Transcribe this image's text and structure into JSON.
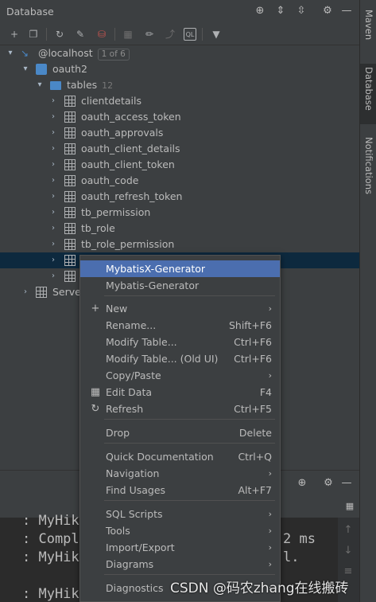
{
  "panel": {
    "title": "Database",
    "header_icons": [
      "crosshair-icon",
      "expand-all-icon",
      "collapse-all-icon",
      "gear-icon",
      "minimize-icon"
    ]
  },
  "toolbar_icons": [
    "add-icon",
    "duplicate-icon",
    "refresh-icon",
    "properties-icon",
    "datasource-icon",
    "table-grid-icon",
    "edit-icon",
    "jump-icon",
    "sql-console-icon",
    "filter-icon"
  ],
  "tree": {
    "datasource": {
      "label": "@localhost",
      "badge": "1 of 6"
    },
    "schema": {
      "label": "oauth2"
    },
    "tables_folder": {
      "label": "tables",
      "count": "12"
    },
    "tables": [
      "clientdetails",
      "oauth_access_token",
      "oauth_approvals",
      "oauth_client_details",
      "oauth_client_token",
      "oauth_code",
      "oauth_refresh_token",
      "tb_permission",
      "tb_role",
      "tb_role_permission",
      "",
      ""
    ],
    "server_node": {
      "label": "Server"
    }
  },
  "right_stripe": {
    "tabs": [
      "Maven",
      "Database",
      "Notifications"
    ]
  },
  "context_menu": {
    "items": [
      {
        "label": "MybatisX-Generator",
        "shortcut": "",
        "submenu": false,
        "icon": "",
        "highlight": true
      },
      {
        "label": "Mybatis-Generator",
        "shortcut": "",
        "submenu": false,
        "icon": ""
      },
      {
        "label": "New",
        "shortcut": "",
        "submenu": true,
        "icon": "plus-icon"
      },
      {
        "label": "Rename...",
        "shortcut": "Shift+F6",
        "submenu": false,
        "icon": ""
      },
      {
        "label": "Modify Table...",
        "shortcut": "Ctrl+F6",
        "submenu": false,
        "icon": ""
      },
      {
        "label": "Modify Table... (Old UI)",
        "shortcut": "Ctrl+F6",
        "submenu": false,
        "icon": ""
      },
      {
        "label": "Copy/Paste",
        "shortcut": "",
        "submenu": true,
        "icon": ""
      },
      {
        "label": "Edit Data",
        "shortcut": "F4",
        "submenu": false,
        "icon": "table-icon"
      },
      {
        "label": "Refresh",
        "shortcut": "Ctrl+F5",
        "submenu": false,
        "icon": "refresh-icon"
      },
      {
        "label": "Drop",
        "shortcut": "Delete",
        "submenu": false,
        "icon": ""
      },
      {
        "label": "Quick Documentation",
        "shortcut": "Ctrl+Q",
        "submenu": false,
        "icon": ""
      },
      {
        "label": "Navigation",
        "shortcut": "",
        "submenu": true,
        "icon": ""
      },
      {
        "label": "Find Usages",
        "shortcut": "Alt+F7",
        "submenu": false,
        "icon": ""
      },
      {
        "label": "SQL Scripts",
        "shortcut": "",
        "submenu": true,
        "icon": ""
      },
      {
        "label": "Tools",
        "shortcut": "",
        "submenu": true,
        "icon": ""
      },
      {
        "label": "Import/Export",
        "shortcut": "",
        "submenu": true,
        "icon": ""
      },
      {
        "label": "Diagrams",
        "shortcut": "",
        "submenu": true,
        "icon": ""
      },
      {
        "label": "Diagnostics",
        "shortcut": "",
        "submenu": true,
        "icon": ""
      }
    ]
  },
  "console": {
    "lines": [
      ": MyHik",
      ": Compl",
      ": MyHik",
      "",
      ": MyHik"
    ],
    "overflow_fragments": [
      "2 ms",
      "l."
    ]
  },
  "watermark": "CSDN @码农zhang在线搬砖",
  "colors": {
    "selection": "#0d293e",
    "menu_highlight": "#4b6eaf",
    "folder": "#4a88c7"
  }
}
